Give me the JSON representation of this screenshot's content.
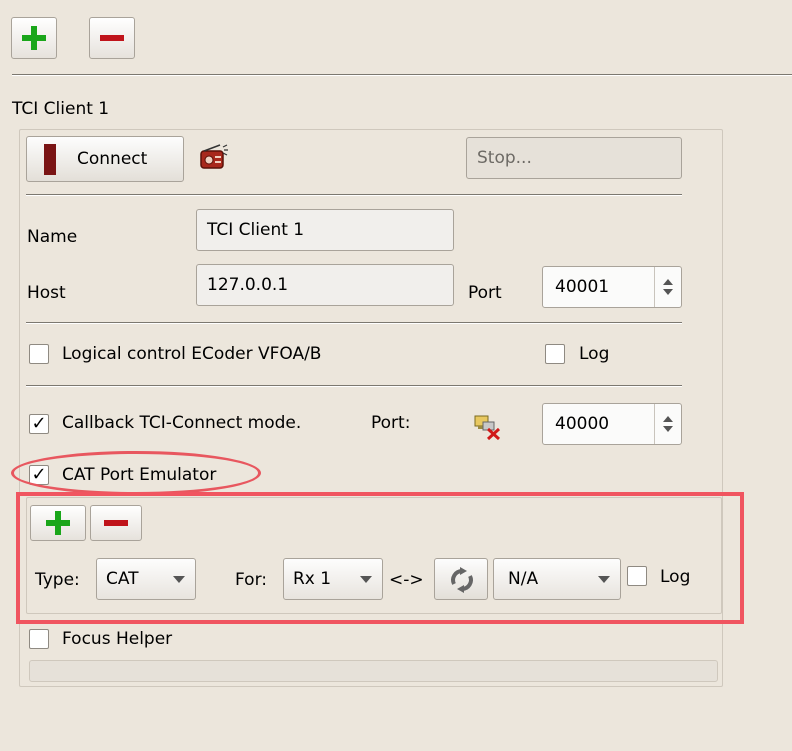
{
  "colors": {
    "window_bg": "#ece6dc",
    "add_green": "#1aa61a",
    "remove_red": "#c0141b",
    "connect_indicator": "#7a1414",
    "annotation_red": "#e8575f"
  },
  "toolbar": {
    "add_icon": "plus-icon",
    "remove_icon": "minus-icon"
  },
  "client": {
    "group_title": "TCI Client 1",
    "connect_label": "Connect",
    "status_icon": "radio-icon",
    "status_value": "Stop...",
    "name_label": "Name",
    "name_value": "TCI Client 1",
    "host_label": "Host",
    "host_value": "127.0.0.1",
    "port_label": "Port",
    "port_value": "40001",
    "logical_control_label": "Logical control ECoder VFOA/B",
    "logical_control_checked": false,
    "log_label": "Log",
    "log_checked": false,
    "callback_label": "Callback TCI-Connect mode.",
    "callback_checked": true,
    "callback_port_label": "Port:",
    "callback_port_icon": "network-disconnected-icon",
    "callback_port_value": "40000",
    "cat_emulator_label": "CAT Port Emulator",
    "cat_emulator_checked": true,
    "focus_helper_label": "Focus Helper",
    "focus_helper_checked": false
  },
  "cat_row": {
    "type_label": "Type:",
    "type_value": "CAT",
    "for_label": "For:",
    "for_value": "Rx 1",
    "arrow_label": "<->",
    "swap_icon": "refresh-icon",
    "port_value": "N/A",
    "log_label": "Log",
    "log_checked": false
  }
}
